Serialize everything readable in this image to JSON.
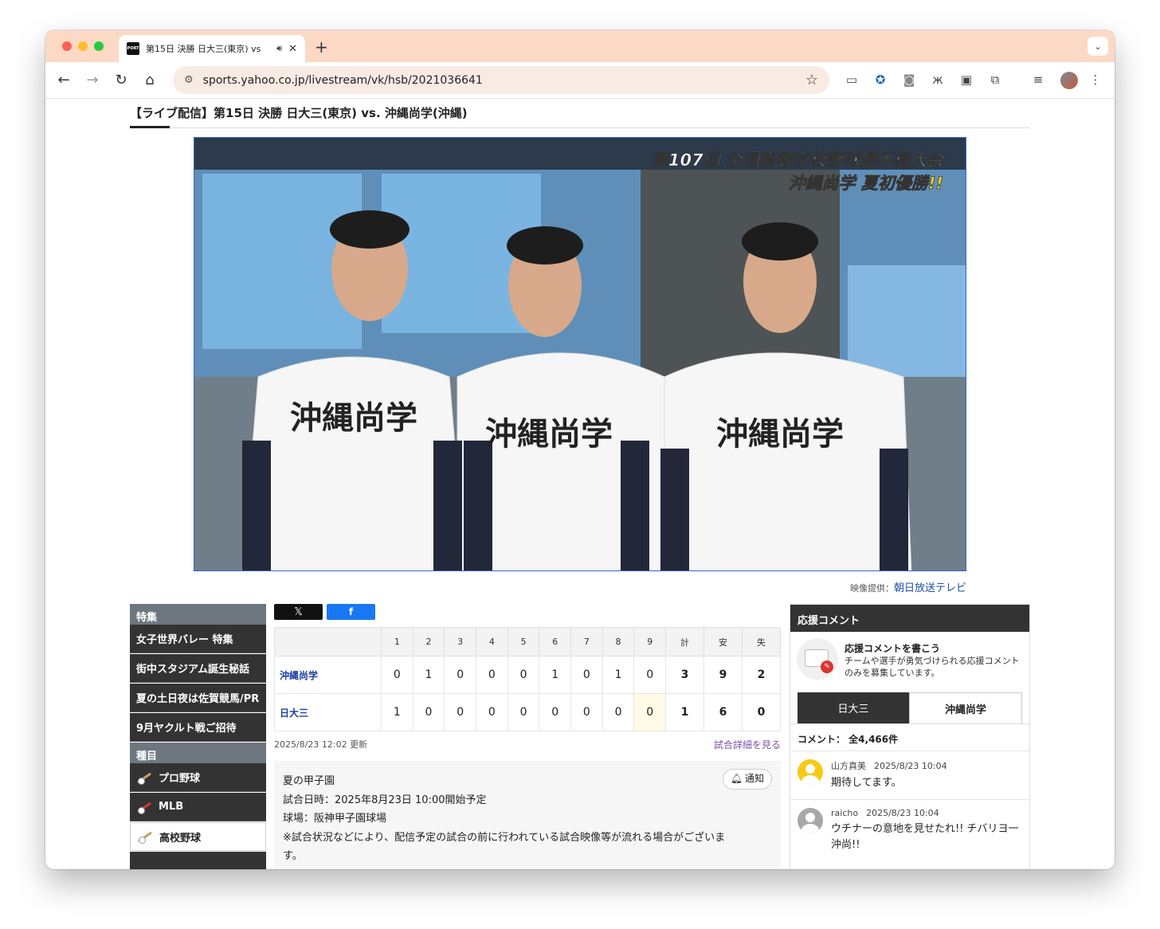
{
  "browser": {
    "tab_title": "第15日 決勝 日大三(東京) vs",
    "url": "sports.yahoo.co.jp/livestream/vk/hsb/2021036641"
  },
  "page": {
    "title": "【ライブ配信】第15日 決勝 日大三(東京) vs. 沖縄尚学(沖縄)"
  },
  "video": {
    "overlay_line1": "第107回 全国高等学校野球選手権大会",
    "overlay_line2": "沖縄尚学 夏初優勝!!",
    "jersey_text": "沖縄尚学",
    "provider_label": "映像提供：",
    "provider_name": "朝日放送テレビ"
  },
  "sidebar": {
    "feature_head": "特集",
    "features": [
      "女子世界バレー 特集",
      "街中スタジアム誕生秘話",
      "夏の土日夜は佐賀競馬/PR",
      "9月ヤクルト戦ご招待"
    ],
    "category_head": "種目",
    "categories": [
      "プロ野球",
      "MLB",
      "高校野球"
    ]
  },
  "share": {
    "x_label": "𝕏",
    "fb_label": "f"
  },
  "scoreboard": {
    "headers": [
      "1",
      "2",
      "3",
      "4",
      "5",
      "6",
      "7",
      "8",
      "9",
      "計",
      "安",
      "失"
    ],
    "rows": [
      {
        "team": "沖縄尚学",
        "cells": [
          "0",
          "1",
          "0",
          "0",
          "0",
          "1",
          "0",
          "1",
          "0",
          "3",
          "9",
          "2"
        ]
      },
      {
        "team": "日大三",
        "cells": [
          "1",
          "0",
          "0",
          "0",
          "0",
          "0",
          "0",
          "0",
          "0",
          "1",
          "6",
          "0"
        ]
      }
    ],
    "updated": "2025/8/23 12:02 更新",
    "detail_link": "試合詳細を見る"
  },
  "match_info": {
    "event": "夏の甲子園",
    "datetime": "試合日時：2025年8月23日 10:00開始予定",
    "venue": "球場：阪神甲子園球場",
    "note": "※試合状況などにより、配信予定の試合の前に行われている試合映像等が流れる場合がございます。",
    "notify_label": "通知"
  },
  "comments": {
    "head": "応援コメント",
    "cta_title": "応援コメントを書こう",
    "cta_desc": "チームや選手が勇気づけられる応援コメントのみを募集しています。",
    "tabs": [
      "日大三",
      "沖縄尚学"
    ],
    "count": "コメント： 全4,466件",
    "items": [
      {
        "user": "山方真美",
        "time": "2025/8/23 10:04",
        "text": "期待してます。"
      },
      {
        "user": "raicho",
        "time": "2025/8/23 10:04",
        "text": "ウチナーの意地を見せたれ!! チバリヨ一沖尚!!"
      }
    ]
  }
}
